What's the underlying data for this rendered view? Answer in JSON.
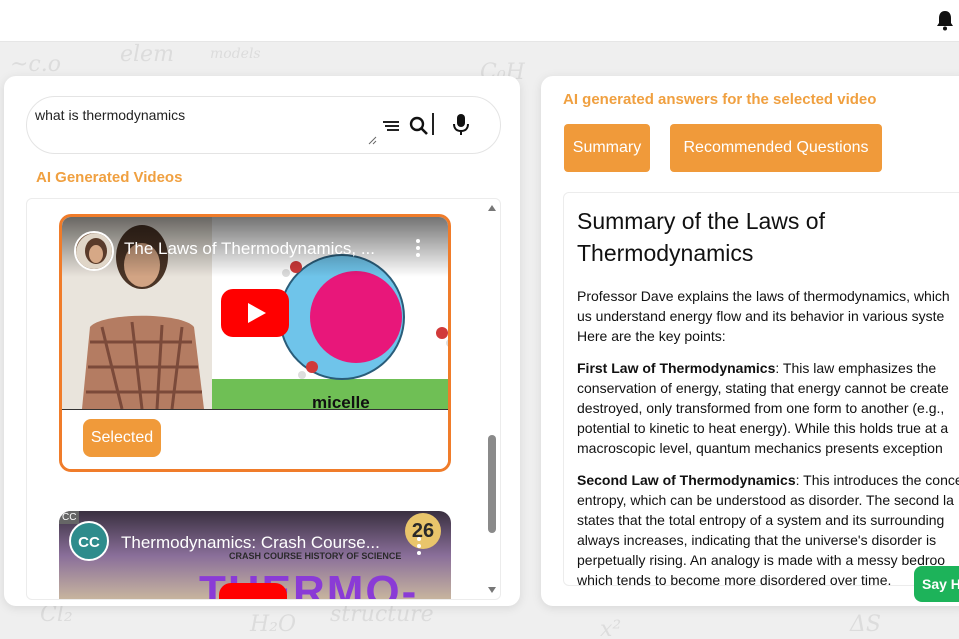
{
  "search": {
    "query": "what is thermodynamics"
  },
  "left": {
    "section_label": "AI Generated Videos",
    "videos": [
      {
        "title": "The Laws of Thermodynamics, ...",
        "thumbnail_caption": "micelle",
        "selected_label": "Selected"
      },
      {
        "title": "Thermodynamics: Crash Course...",
        "thumbnail_text": "THERMO-",
        "thumbnail_subtitle": "CRASH COURSE HISTORY OF SCIENCE",
        "episode_badge": "26",
        "cc_tag": "CC",
        "channel_logo": "CC"
      }
    ]
  },
  "right": {
    "heading": "AI generated answers for the selected video",
    "tabs": [
      "Summary",
      "Recommended Questions"
    ],
    "answer": {
      "title": "Summary of the Laws of Thermodynamics",
      "intro": [
        "Professor Dave explains the laws of thermodynamics, which",
        "us understand energy flow and its behavior in various syste",
        "Here are the key points:"
      ],
      "first_law_label": "First Law of Thermodynamics",
      "first_law": [
        ": This law emphasizes the",
        "conservation of energy, stating that energy cannot be create",
        "destroyed, only transformed from one form to another (e.g.,",
        "potential to kinetic to heat energy). While this holds true at a",
        "macroscopic level, quantum mechanics presents exception"
      ],
      "second_law_label": "Second Law of Thermodynamics",
      "second_law": [
        ": This introduces the conce",
        "entropy, which can be understood as disorder. The second la",
        "states that the total entropy of a system and its surrounding",
        "always increases, indicating that the universe's disorder is",
        "perpetually rising. An analogy is made with a messy bedroo",
        "which tends to become more disordered over time."
      ]
    },
    "say_button": "Say H"
  },
  "colors": {
    "accent": "#f09a3a",
    "selected_border": "#f07c2a",
    "say_green": "#1db35a"
  },
  "icons": [
    "bell-icon",
    "menu-icon",
    "search-icon",
    "mic-icon",
    "play-icon",
    "more-vert-icon"
  ]
}
